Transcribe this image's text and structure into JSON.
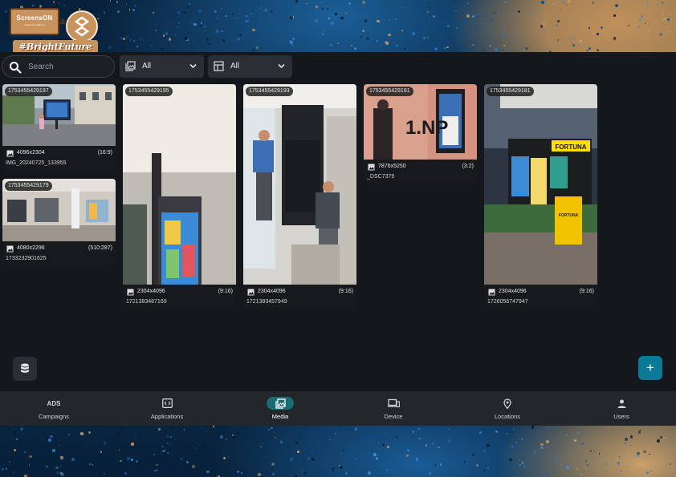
{
  "logo": {
    "brand": "ScreensON",
    "sub": "network solutions",
    "amp": "&",
    "tagline": "#BrightFuture"
  },
  "toolbar": {
    "search_placeholder": "Search",
    "filter1_value": "All",
    "filter2_value": "All"
  },
  "media": [
    {
      "id": "1753455429197",
      "resolution": "4096x2304",
      "ratio": "(16:9)",
      "filename": "IMG_20240725_133955"
    },
    {
      "id": "1753455429179",
      "resolution": "4080x2296",
      "ratio": "(510:287)",
      "filename": "1733232901625"
    },
    {
      "id": "1753455429195",
      "resolution": "2304x4096",
      "ratio": "(9:16)",
      "filename": "1721383487169"
    },
    {
      "id": "1753455429193",
      "resolution": "2304x4096",
      "ratio": "(9:16)",
      "filename": "1721383457949"
    },
    {
      "id": "1753455429191",
      "resolution": "7876x5250",
      "ratio": "(3:2)",
      "filename": "_DSC7379"
    },
    {
      "id": "1753455429181",
      "resolution": "2304x4096",
      "ratio": "(9:16)",
      "filename": "1726056747947"
    }
  ],
  "photo_text": {
    "storefront_sign": "FORTUNA",
    "bin_label": "FORTUNA",
    "floor_sign": "1.NP"
  },
  "fab": {
    "add_label": "+"
  },
  "nav": [
    {
      "label": "Campaigns",
      "icon": "ads-icon",
      "icon_text": "ADS",
      "active": false
    },
    {
      "label": "Applications",
      "icon": "code-window-icon",
      "active": false
    },
    {
      "label": "Media",
      "icon": "media-gallery-icon",
      "active": true
    },
    {
      "label": "Device",
      "icon": "devices-icon",
      "active": false
    },
    {
      "label": "Locations",
      "icon": "location-pin-icon",
      "active": false
    },
    {
      "label": "Users",
      "icon": "person-icon",
      "active": false
    }
  ],
  "colors": {
    "accent": "#1a6c74",
    "fab": "#0a7a96",
    "panel": "#14171b"
  }
}
